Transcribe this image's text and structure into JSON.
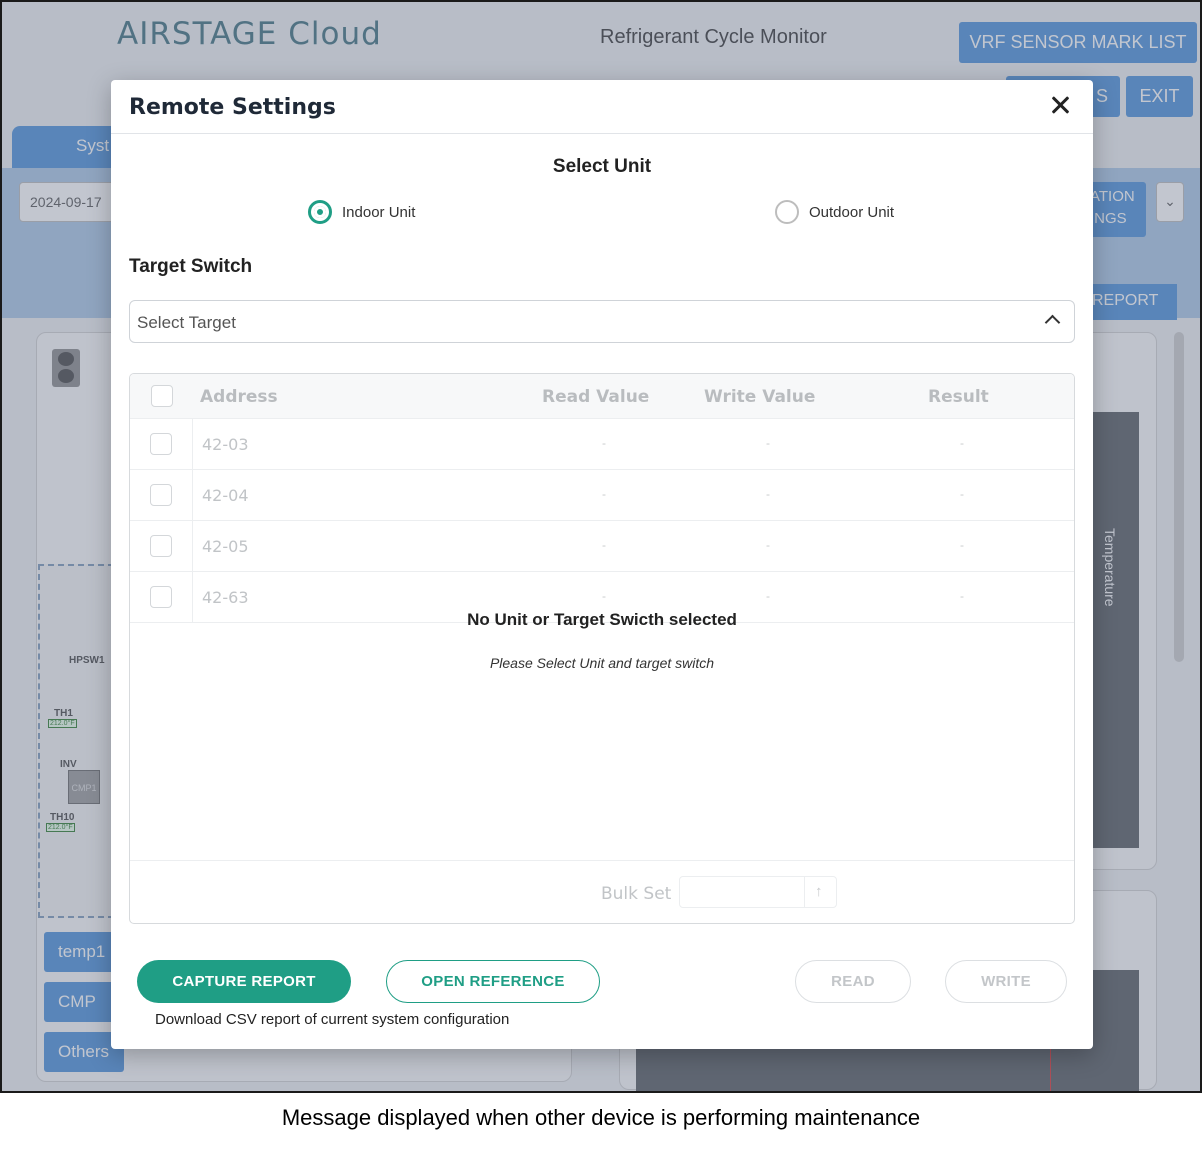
{
  "app": {
    "logo": "AIRSTAGE Cloud",
    "title": "Refrigerant Cycle Monitor",
    "vrf_sensor_button": "VRF SENSOR MARK LIST",
    "settings_button_partial": "S",
    "exit_button": "EXIT",
    "system_tab_partial": "Syst",
    "date_value": "2024-09-17",
    "operation_button_partial": [
      "ATION",
      "INGS"
    ],
    "report_button_partial": "REPORT",
    "side_buttons": [
      "temp1",
      "CMP",
      "Others"
    ],
    "chart_axis_label": "Temperature",
    "diagram_labels": {
      "hpsw": "HPSW1",
      "th1": "TH1",
      "th1_temp": "212.0°F",
      "inv": "INV",
      "cmp": "CMP1",
      "th10": "TH10",
      "th10_temp": "212.0°F"
    }
  },
  "modal": {
    "title": "Remote Settings",
    "select_unit_title": "Select Unit",
    "unit_options": [
      {
        "label": "Indoor Unit",
        "selected": true
      },
      {
        "label": "Outdoor Unit",
        "selected": false
      }
    ],
    "target_switch_title": "Target Switch",
    "target_placeholder": "Select Target",
    "table": {
      "columns": [
        "Address",
        "Read Value",
        "Write Value",
        "Result"
      ],
      "rows": [
        {
          "address": "42-03",
          "read": "-",
          "write": "-",
          "result": "-"
        },
        {
          "address": "42-04",
          "read": "-",
          "write": "-",
          "result": "-"
        },
        {
          "address": "42-05",
          "read": "-",
          "write": "-",
          "result": "-"
        },
        {
          "address": "42-63",
          "read": "-",
          "write": "-",
          "result": "-"
        }
      ],
      "empty_title": "No Unit or Target Swicth selected",
      "empty_subtitle": "Please Select Unit and target switch",
      "bulk_set_label": "Bulk Set"
    },
    "buttons": {
      "capture_report": "CAPTURE REPORT",
      "open_reference": "OPEN REFERENCE",
      "read": "READ",
      "write": "WRITE"
    },
    "hint": "Download CSV report of current system configuration"
  },
  "caption": "Message displayed when other device is performing maintenance",
  "colors": {
    "accent": "#1f9e85",
    "app_blue": "#4a90d9",
    "overlay": "rgba(110,120,140,0.42)"
  }
}
